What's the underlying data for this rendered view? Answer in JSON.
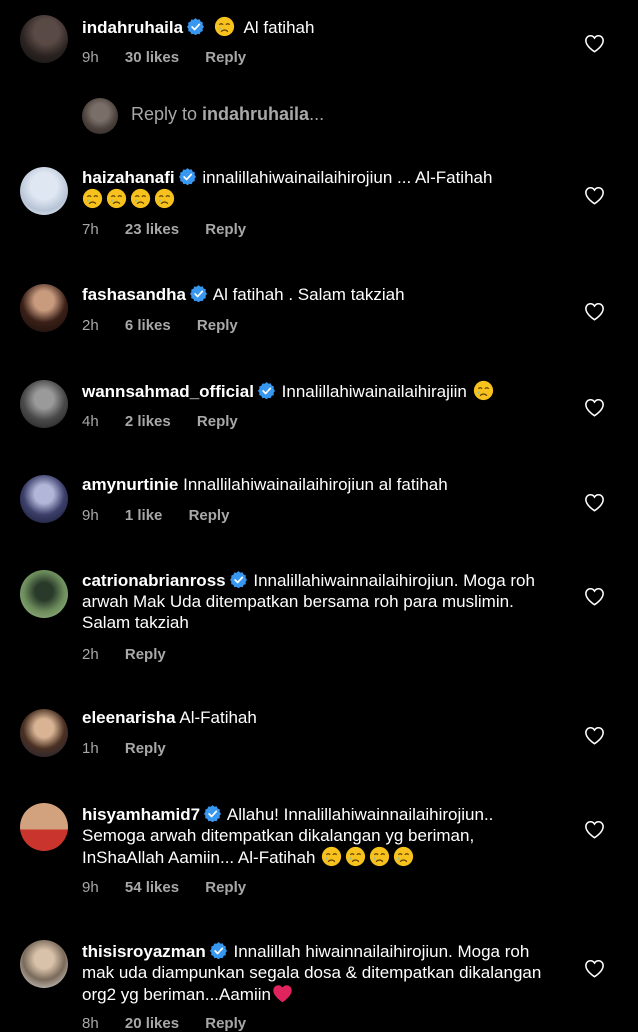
{
  "comments": [
    {
      "username": "indahruhaila",
      "verified": true,
      "text": "Al fatihah",
      "emoji_count": 1,
      "time": "9h",
      "likes": "30 likes",
      "reply": "Reply"
    },
    {
      "username": "haizahanafi",
      "verified": true,
      "text": "innalillahiwainailaihirojiun ... Al-Fatihah",
      "emoji_count": 4,
      "time": "7h",
      "likes": "23 likes",
      "reply": "Reply"
    },
    {
      "username": "fashasandha",
      "verified": true,
      "text": "Al fatihah . Salam takziah",
      "emoji_count": 0,
      "time": "2h",
      "likes": "6 likes",
      "reply": "Reply"
    },
    {
      "username": "wannsahmad_official",
      "verified": true,
      "text": "Innalillahiwainailaihirajiin",
      "emoji_count": 1,
      "time": "4h",
      "likes": "2 likes",
      "reply": "Reply"
    },
    {
      "username": "amynurtinie",
      "verified": false,
      "text": "Innallilahiwainailaihirojiun al fatihah",
      "emoji_count": 0,
      "time": "9h",
      "likes": "1 like",
      "reply": "Reply"
    },
    {
      "username": "catrionabrianross",
      "verified": true,
      "text": "Innalillahiwainnailaihirojiun. Moga roh arwah Mak Uda ditempatkan bersama roh para muslimin. Salam takziah",
      "emoji_count": 0,
      "time": "2h",
      "likes": "",
      "reply": "Reply"
    },
    {
      "username": "eleenarisha",
      "verified": false,
      "text": "Al-Fatihah",
      "emoji_count": 0,
      "time": "1h",
      "likes": "",
      "reply": "Reply"
    },
    {
      "username": "hisyamhamid7",
      "verified": true,
      "text": "Allahu! Innalillahiwainnailaihirojiun.. Semoga arwah ditempatkan dikalangan yg beriman, InShaAllah Aamiin... Al-Fatihah",
      "emoji_count": 4,
      "time": "9h",
      "likes": "54 likes",
      "reply": "Reply"
    },
    {
      "username": "thisisroyazman",
      "verified": true,
      "text": "Innalillah hiwainnailaihirojiun. Moga roh mak uda diampunkan segala dosa & ditempatkan dikalangan org2 yg beriman...Aamiin",
      "emoji_count": 0,
      "heart_emoji": true,
      "time": "8h",
      "likes": "20 likes",
      "reply": "Reply"
    }
  ],
  "reply_bar": {
    "prefix": "Reply to ",
    "username": "indahruhaila",
    "suffix": "..."
  },
  "icons": {
    "verified": "verified-badge-icon",
    "heart": "heart-outline-icon",
    "emoji": "crying-face-emoji"
  },
  "colors": {
    "background": "#000000",
    "text": "#ffffff",
    "meta": "#a8a8a8",
    "verified": "#3897f0"
  }
}
